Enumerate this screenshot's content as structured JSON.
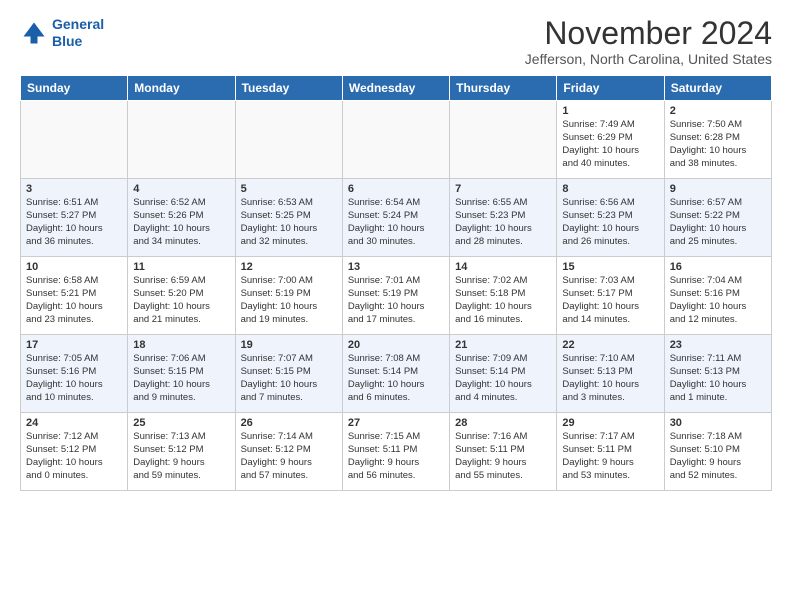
{
  "header": {
    "logo_line1": "General",
    "logo_line2": "Blue",
    "month": "November 2024",
    "location": "Jefferson, North Carolina, United States"
  },
  "weekdays": [
    "Sunday",
    "Monday",
    "Tuesday",
    "Wednesday",
    "Thursday",
    "Friday",
    "Saturday"
  ],
  "weeks": [
    [
      {
        "day": "",
        "info": ""
      },
      {
        "day": "",
        "info": ""
      },
      {
        "day": "",
        "info": ""
      },
      {
        "day": "",
        "info": ""
      },
      {
        "day": "",
        "info": ""
      },
      {
        "day": "1",
        "info": "Sunrise: 7:49 AM\nSunset: 6:29 PM\nDaylight: 10 hours\nand 40 minutes."
      },
      {
        "day": "2",
        "info": "Sunrise: 7:50 AM\nSunset: 6:28 PM\nDaylight: 10 hours\nand 38 minutes."
      }
    ],
    [
      {
        "day": "3",
        "info": "Sunrise: 6:51 AM\nSunset: 5:27 PM\nDaylight: 10 hours\nand 36 minutes."
      },
      {
        "day": "4",
        "info": "Sunrise: 6:52 AM\nSunset: 5:26 PM\nDaylight: 10 hours\nand 34 minutes."
      },
      {
        "day": "5",
        "info": "Sunrise: 6:53 AM\nSunset: 5:25 PM\nDaylight: 10 hours\nand 32 minutes."
      },
      {
        "day": "6",
        "info": "Sunrise: 6:54 AM\nSunset: 5:24 PM\nDaylight: 10 hours\nand 30 minutes."
      },
      {
        "day": "7",
        "info": "Sunrise: 6:55 AM\nSunset: 5:23 PM\nDaylight: 10 hours\nand 28 minutes."
      },
      {
        "day": "8",
        "info": "Sunrise: 6:56 AM\nSunset: 5:23 PM\nDaylight: 10 hours\nand 26 minutes."
      },
      {
        "day": "9",
        "info": "Sunrise: 6:57 AM\nSunset: 5:22 PM\nDaylight: 10 hours\nand 25 minutes."
      }
    ],
    [
      {
        "day": "10",
        "info": "Sunrise: 6:58 AM\nSunset: 5:21 PM\nDaylight: 10 hours\nand 23 minutes."
      },
      {
        "day": "11",
        "info": "Sunrise: 6:59 AM\nSunset: 5:20 PM\nDaylight: 10 hours\nand 21 minutes."
      },
      {
        "day": "12",
        "info": "Sunrise: 7:00 AM\nSunset: 5:19 PM\nDaylight: 10 hours\nand 19 minutes."
      },
      {
        "day": "13",
        "info": "Sunrise: 7:01 AM\nSunset: 5:19 PM\nDaylight: 10 hours\nand 17 minutes."
      },
      {
        "day": "14",
        "info": "Sunrise: 7:02 AM\nSunset: 5:18 PM\nDaylight: 10 hours\nand 16 minutes."
      },
      {
        "day": "15",
        "info": "Sunrise: 7:03 AM\nSunset: 5:17 PM\nDaylight: 10 hours\nand 14 minutes."
      },
      {
        "day": "16",
        "info": "Sunrise: 7:04 AM\nSunset: 5:16 PM\nDaylight: 10 hours\nand 12 minutes."
      }
    ],
    [
      {
        "day": "17",
        "info": "Sunrise: 7:05 AM\nSunset: 5:16 PM\nDaylight: 10 hours\nand 10 minutes."
      },
      {
        "day": "18",
        "info": "Sunrise: 7:06 AM\nSunset: 5:15 PM\nDaylight: 10 hours\nand 9 minutes."
      },
      {
        "day": "19",
        "info": "Sunrise: 7:07 AM\nSunset: 5:15 PM\nDaylight: 10 hours\nand 7 minutes."
      },
      {
        "day": "20",
        "info": "Sunrise: 7:08 AM\nSunset: 5:14 PM\nDaylight: 10 hours\nand 6 minutes."
      },
      {
        "day": "21",
        "info": "Sunrise: 7:09 AM\nSunset: 5:14 PM\nDaylight: 10 hours\nand 4 minutes."
      },
      {
        "day": "22",
        "info": "Sunrise: 7:10 AM\nSunset: 5:13 PM\nDaylight: 10 hours\nand 3 minutes."
      },
      {
        "day": "23",
        "info": "Sunrise: 7:11 AM\nSunset: 5:13 PM\nDaylight: 10 hours\nand 1 minute."
      }
    ],
    [
      {
        "day": "24",
        "info": "Sunrise: 7:12 AM\nSunset: 5:12 PM\nDaylight: 10 hours\nand 0 minutes."
      },
      {
        "day": "25",
        "info": "Sunrise: 7:13 AM\nSunset: 5:12 PM\nDaylight: 9 hours\nand 59 minutes."
      },
      {
        "day": "26",
        "info": "Sunrise: 7:14 AM\nSunset: 5:12 PM\nDaylight: 9 hours\nand 57 minutes."
      },
      {
        "day": "27",
        "info": "Sunrise: 7:15 AM\nSunset: 5:11 PM\nDaylight: 9 hours\nand 56 minutes."
      },
      {
        "day": "28",
        "info": "Sunrise: 7:16 AM\nSunset: 5:11 PM\nDaylight: 9 hours\nand 55 minutes."
      },
      {
        "day": "29",
        "info": "Sunrise: 7:17 AM\nSunset: 5:11 PM\nDaylight: 9 hours\nand 53 minutes."
      },
      {
        "day": "30",
        "info": "Sunrise: 7:18 AM\nSunset: 5:10 PM\nDaylight: 9 hours\nand 52 minutes."
      }
    ]
  ]
}
